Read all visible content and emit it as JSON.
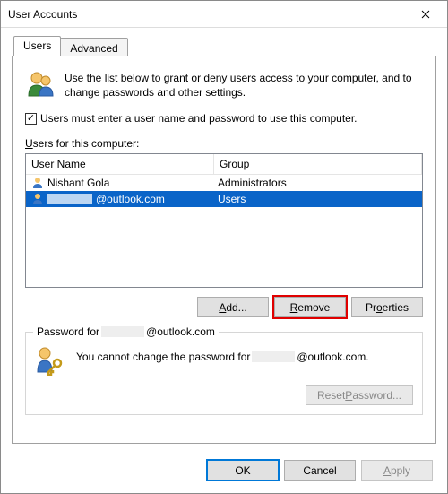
{
  "window": {
    "title": "User Accounts"
  },
  "tabs": {
    "users": "Users",
    "advanced": "Advanced"
  },
  "intro": "Use the list below to grant or deny users access to your computer, and to change passwords and other settings.",
  "checkbox": {
    "checked": true,
    "label": "Users must enter a user name and password to use this computer."
  },
  "list": {
    "label_prefix": "U",
    "label_rest": "sers for this computer:",
    "col_user": "User Name",
    "col_group": "Group",
    "rows": [
      {
        "name": "Nishant Gola",
        "group": "Administrators",
        "selected": false,
        "masked": false
      },
      {
        "name": "@outlook.com",
        "group": "Users",
        "selected": true,
        "masked": true
      }
    ]
  },
  "buttons": {
    "add": "dd...",
    "add_u": "A",
    "remove": "emove",
    "remove_u": "R",
    "properties": "erties",
    "properties_pre": "Pr",
    "properties_u": "o"
  },
  "pwgroup": {
    "legend_prefix": "Password for",
    "legend_suffix": "@outlook.com",
    "msg_prefix": "You cannot change the password for",
    "msg_suffix": "@outlook.com.",
    "reset_pre": "Reset ",
    "reset_u": "P",
    "reset_post": "assword..."
  },
  "dialog": {
    "ok": "OK",
    "cancel": "Cancel",
    "apply": "pply",
    "apply_u": "A"
  }
}
